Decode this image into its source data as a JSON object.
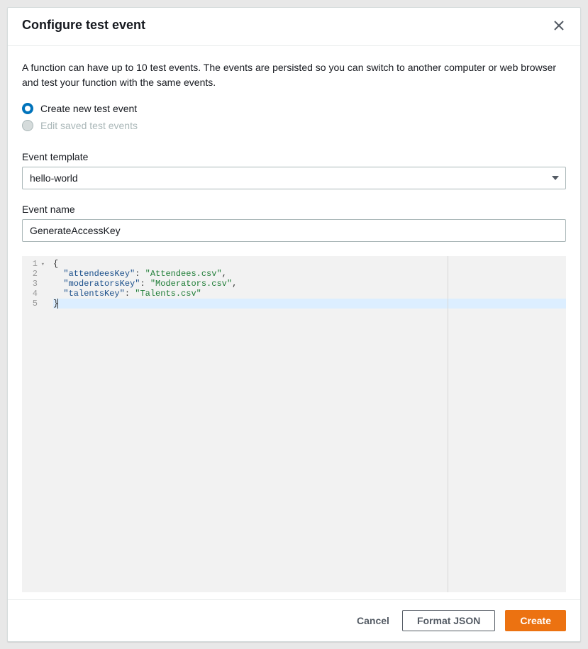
{
  "modal": {
    "title": "Configure test event",
    "intro": "A function can have up to 10 test events. The events are persisted so you can switch to another computer or web browser and test your function with the same events.",
    "radios": {
      "create_new": "Create new test event",
      "edit_saved": "Edit saved test events"
    },
    "template_label": "Event template",
    "template_value": "hello-world",
    "name_label": "Event name",
    "name_value": "GenerateAccessKey",
    "code": {
      "keys": [
        "attendeesKey",
        "moderatorsKey",
        "talentsKey"
      ],
      "values": [
        "Attendees.csv",
        "Moderators.csv",
        "Talents.csv"
      ],
      "line_numbers": [
        "1",
        "2",
        "3",
        "4",
        "5"
      ]
    },
    "footer": {
      "cancel": "Cancel",
      "format": "Format JSON",
      "create": "Create"
    }
  }
}
